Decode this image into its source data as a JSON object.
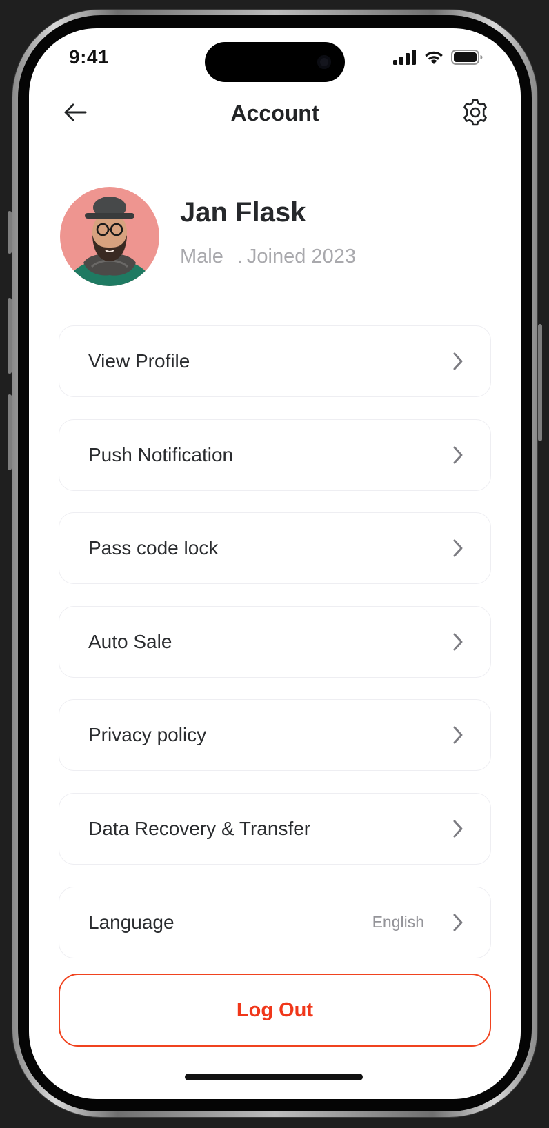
{
  "status_bar": {
    "time": "9:41"
  },
  "header": {
    "title": "Account"
  },
  "profile": {
    "name": "Jan Flask",
    "gender": "Male",
    "dot": ".",
    "joined": "Joined 2023"
  },
  "menu": {
    "items": [
      {
        "label": "View Profile"
      },
      {
        "label": "Push Notification"
      },
      {
        "label": "Pass code lock"
      },
      {
        "label": "Auto Sale"
      },
      {
        "label": "Privacy policy"
      },
      {
        "label": "Data Recovery & Transfer"
      },
      {
        "label": "Language",
        "value": "English"
      }
    ]
  },
  "logout": {
    "label": "Log Out"
  },
  "colors": {
    "accent": "#F0371A",
    "avatar_bg": "#EE9590",
    "text": "#26282B",
    "muted": "#A9A9AD"
  },
  "icons": [
    "back-arrow-icon",
    "gear-icon",
    "chevron-right-icon",
    "signal-icon",
    "wifi-icon",
    "battery-icon"
  ]
}
